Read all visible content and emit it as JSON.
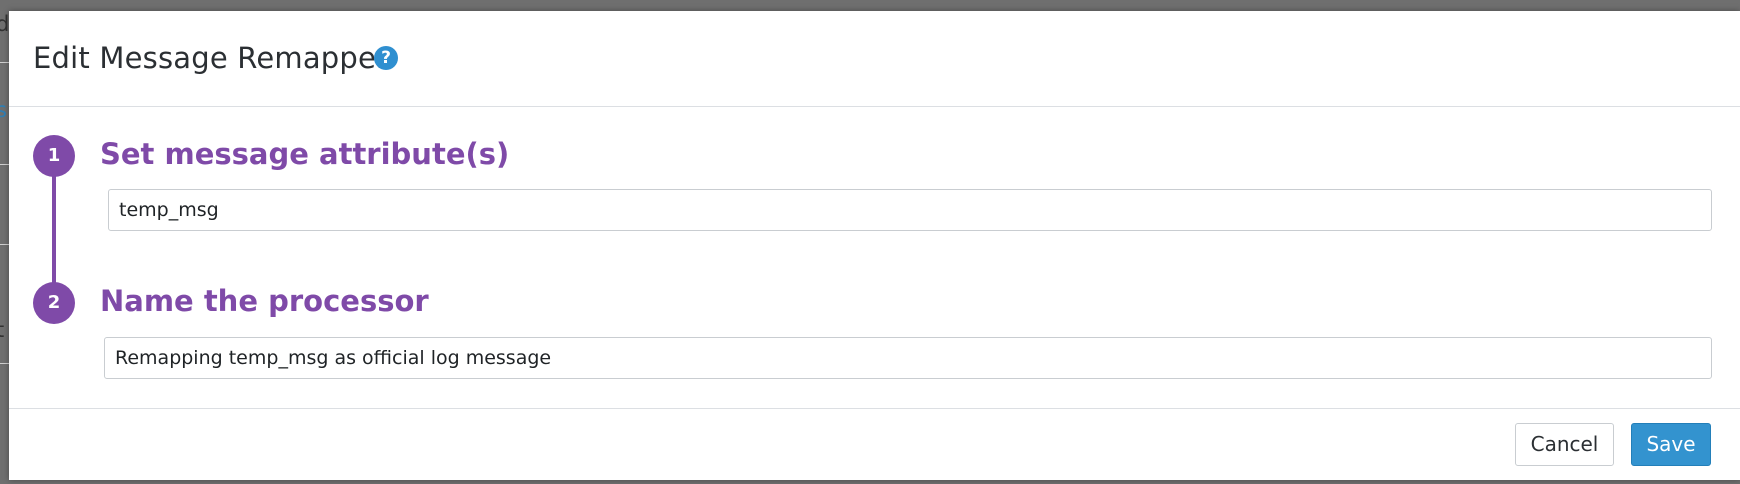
{
  "background": {
    "fragments": [
      "d",
      "s",
      "t"
    ]
  },
  "dialog": {
    "title": "Edit Message Remapper",
    "help_icon": "?"
  },
  "steps": [
    {
      "number": "1",
      "title": "Set message attribute(s)",
      "input_value": "temp_msg"
    },
    {
      "number": "2",
      "title": "Name the processor",
      "input_value": "Remapping temp_msg as official log message"
    }
  ],
  "footer": {
    "cancel_label": "Cancel",
    "save_label": "Save"
  },
  "colors": {
    "accent_purple": "#7f4aa8",
    "primary_blue": "#3393cf",
    "help_blue": "#2f8fd0"
  },
  "icons": {
    "help": "question-circle-icon"
  }
}
